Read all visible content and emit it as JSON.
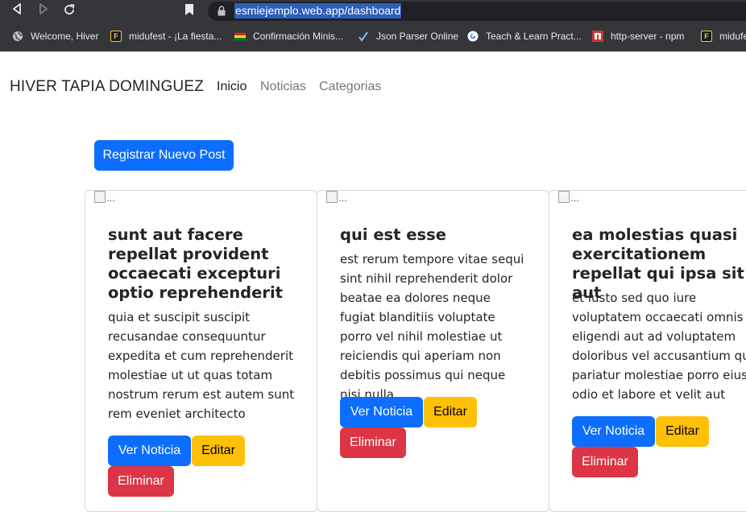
{
  "browser": {
    "url": "esmiejemplo.web.app/dashboard",
    "bookmarks": [
      {
        "label": "Welcome, Hiver",
        "icon": "globe-icon"
      },
      {
        "label": "midufest - ¡La fiesta...",
        "icon": "midudev-f-icon"
      },
      {
        "label": "Confirmación Minis...",
        "icon": "flag-icon"
      },
      {
        "label": "Json Parser Online",
        "icon": "check-icon"
      },
      {
        "label": "Teach & Learn Pract...",
        "icon": "google-icon"
      },
      {
        "label": "http-server - npm",
        "icon": "npm-icon"
      },
      {
        "label": "midufe",
        "icon": "midudev-f-icon"
      }
    ]
  },
  "navbar": {
    "brand": "HIVER TAPIA DOMINGUEZ",
    "links": [
      "Inicio",
      "Noticias",
      "Categorias"
    ],
    "active_link": "Inicio"
  },
  "actions": {
    "register_post": "Registrar Nuevo Post"
  },
  "image_alt": "...",
  "posts": [
    {
      "title": "sunt aut facere repellat provident occaecati excepturi optio reprehenderit",
      "body": "quia et suscipit suscipit recusandae consequuntur expedita et cum reprehenderit molestiae ut ut quas totam nostrum rerum est autem sunt rem eveniet architecto"
    },
    {
      "title": "qui est esse",
      "body": "est rerum tempore vitae sequi sint nihil reprehenderit dolor beatae ea dolores neque fugiat blanditiis voluptate porro vel nihil molestiae ut reiciendis qui aperiam non debitis possimus qui neque nisi nulla"
    },
    {
      "title": "ea molestias quasi exercitationem repellat qui ipsa sit aut",
      "body": "et iusto sed quo iure voluptatem occaecati omnis eligendi aut ad voluptatem doloribus vel accusantium quis pariatur molestiae porro eius odio et labore et velit aut"
    }
  ],
  "card_buttons": {
    "view": "Ver Noticia",
    "edit": "Editar",
    "delete": "Eliminar"
  },
  "colors": {
    "primary": "#0d6efd",
    "warning": "#ffc107",
    "danger": "#dc3545"
  }
}
